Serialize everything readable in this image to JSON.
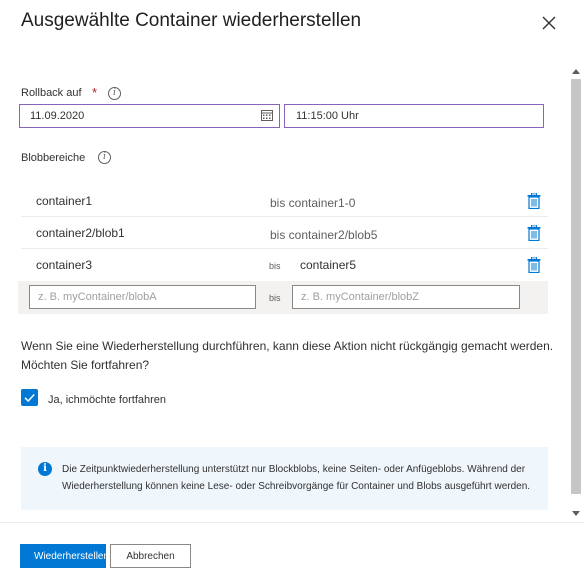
{
  "dialog": {
    "title": "Ausgewählte Container wiederherstellen"
  },
  "rollback": {
    "label": "Rollback auf",
    "required_mark": "*",
    "date_value": "11.09.2020",
    "time_value": "11:15:00 Uhr"
  },
  "blob_ranges": {
    "label": "Blobbereiche",
    "rows": [
      {
        "from": "container1",
        "to": "bis container1-0"
      },
      {
        "from": "container2/blob1",
        "to": "bis container2/blob5"
      },
      {
        "from": "container3",
        "to_prefix": "bis",
        "to": "container5"
      }
    ],
    "new_row": {
      "from_placeholder": "z. B. myContainer/blobA",
      "separator": "bis",
      "to_placeholder": "z. B. myContainer/blobZ"
    }
  },
  "warning": {
    "text": "Wenn Sie eine Wiederherstellung durchführen, kann diese Aktion nicht rückgängig gemacht werden. Möchten Sie fortfahren?"
  },
  "confirm": {
    "label": "Ja, ichmöchte fortfahren",
    "checked": true
  },
  "info_box": {
    "text": "Die Zeitpunktwiederherstellung unterstützt nur Blockblobs, keine Seiten- oder Anfügeblobs. Während der Wiederherstellung können keine Lese- oder Schreibvorgänge für Container und Blobs ausgeführt werden."
  },
  "footer": {
    "primary_label": "Wiederherstellen",
    "secondary_label": "Abbrechen"
  },
  "colors": {
    "accent": "#0078d4",
    "focus_border": "#8764b8",
    "info_background": "#eff6fc",
    "required": "#a4262c"
  },
  "icons": {
    "close": "close-icon",
    "info": "info-icon",
    "calendar": "calendar-icon",
    "delete": "trash-icon",
    "check": "checkmark-icon"
  }
}
